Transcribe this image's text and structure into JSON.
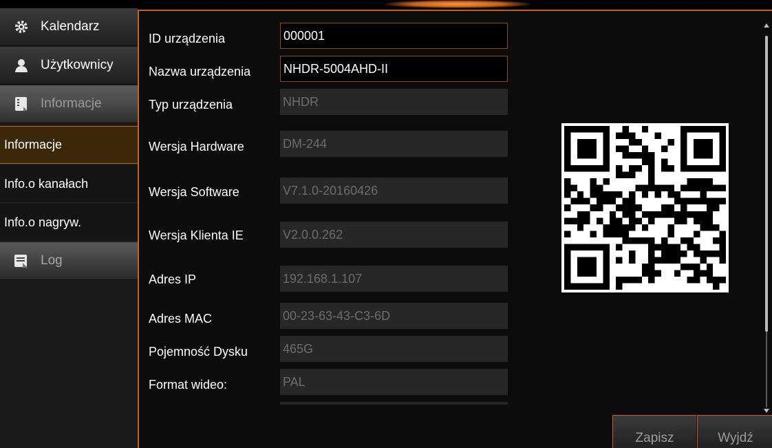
{
  "sidebar": {
    "top_items": [
      {
        "label": "Kalendarz",
        "icon": "gear-icon"
      },
      {
        "label": "Użytkownicy",
        "icon": "user-icon"
      },
      {
        "label": "Informacje",
        "icon": "info-book-icon"
      }
    ],
    "sub_items": [
      {
        "label": "Informacje"
      },
      {
        "label": "Info.o kanałach"
      },
      {
        "label": "Info.o nagryw."
      }
    ],
    "log": {
      "label": "Log",
      "icon": "log-list-icon"
    }
  },
  "form": {
    "rows": [
      {
        "label": "ID urządzenia",
        "value": "000001"
      },
      {
        "label": "Nazwa urządzenia",
        "value": "NHDR-5004AHD-II"
      },
      {
        "label": "Typ urządzenia",
        "value": "NHDR"
      },
      {
        "label": "Wersja Hardware",
        "value": "DM-244"
      },
      {
        "label": "Wersja Software",
        "value": "V7.1.0-20160426"
      },
      {
        "label": "Wersja Klienta IE",
        "value": "V2.0.0.262"
      },
      {
        "label": "Adres IP",
        "value": "192.168.1.107"
      },
      {
        "label": "Adres MAC",
        "value": "00-23-63-43-C3-6D"
      },
      {
        "label": "Pojemność Dysku",
        "value": "465G"
      },
      {
        "label": "Format wideo:",
        "value": "PAL"
      }
    ]
  },
  "buttons": {
    "save": "Zapisz",
    "exit": "Wyjdź"
  },
  "colors": {
    "accent": "#c4621c",
    "selected_bg": "#3a2808",
    "field_readonly": "#272727"
  }
}
